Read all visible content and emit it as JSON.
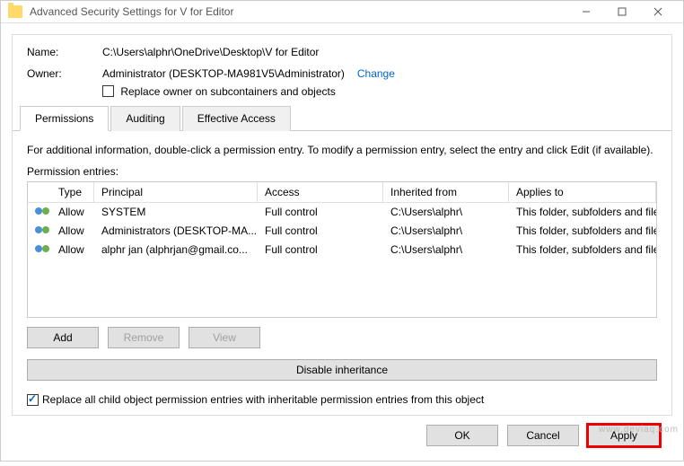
{
  "window": {
    "title": "Advanced Security Settings for V for Editor"
  },
  "name": {
    "label": "Name:",
    "value": "C:\\Users\\alphr\\OneDrive\\Desktop\\V for Editor"
  },
  "owner": {
    "label": "Owner:",
    "value": "Administrator (DESKTOP-MA981V5\\Administrator)",
    "change": "Change",
    "replace_label": "Replace owner on subcontainers and objects"
  },
  "tabs": {
    "perm": "Permissions",
    "audit": "Auditing",
    "eff": "Effective Access"
  },
  "info_text": "For additional information, double-click a permission entry. To modify a permission entry, select the entry and click Edit (if available).",
  "entries_label": "Permission entries:",
  "headers": {
    "type": "Type",
    "principal": "Principal",
    "access": "Access",
    "inherited": "Inherited from",
    "applies": "Applies to"
  },
  "rows": [
    {
      "type": "Allow",
      "principal": "SYSTEM",
      "access": "Full control",
      "inherited": "C:\\Users\\alphr\\",
      "applies": "This folder, subfolders and files"
    },
    {
      "type": "Allow",
      "principal": "Administrators (DESKTOP-MA...",
      "access": "Full control",
      "inherited": "C:\\Users\\alphr\\",
      "applies": "This folder, subfolders and files"
    },
    {
      "type": "Allow",
      "principal": "alphr jan (alphrjan@gmail.co...",
      "access": "Full control",
      "inherited": "C:\\Users\\alphr\\",
      "applies": "This folder, subfolders and files"
    }
  ],
  "buttons": {
    "add": "Add",
    "remove": "Remove",
    "view": "View",
    "disable": "Disable inheritance"
  },
  "replace_entries": "Replace all child object permission entries with inheritable permission entries from this object",
  "footer": {
    "ok": "OK",
    "cancel": "Cancel",
    "apply": "Apply"
  },
  "watermark": "www.deviaq.com"
}
